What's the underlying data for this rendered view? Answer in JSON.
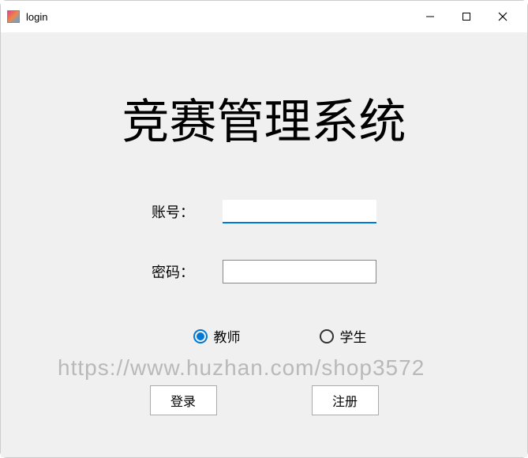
{
  "window": {
    "title": "login"
  },
  "main": {
    "heading": "竞赛管理系统"
  },
  "form": {
    "account_label": "账号：",
    "account_value": "",
    "password_label": "密码：",
    "password_value": ""
  },
  "role": {
    "teacher_label": "教师",
    "student_label": "学生",
    "selected": "teacher"
  },
  "buttons": {
    "login_label": "登录",
    "register_label": "注册"
  },
  "watermark": "https://www.huzhan.com/shop3572"
}
